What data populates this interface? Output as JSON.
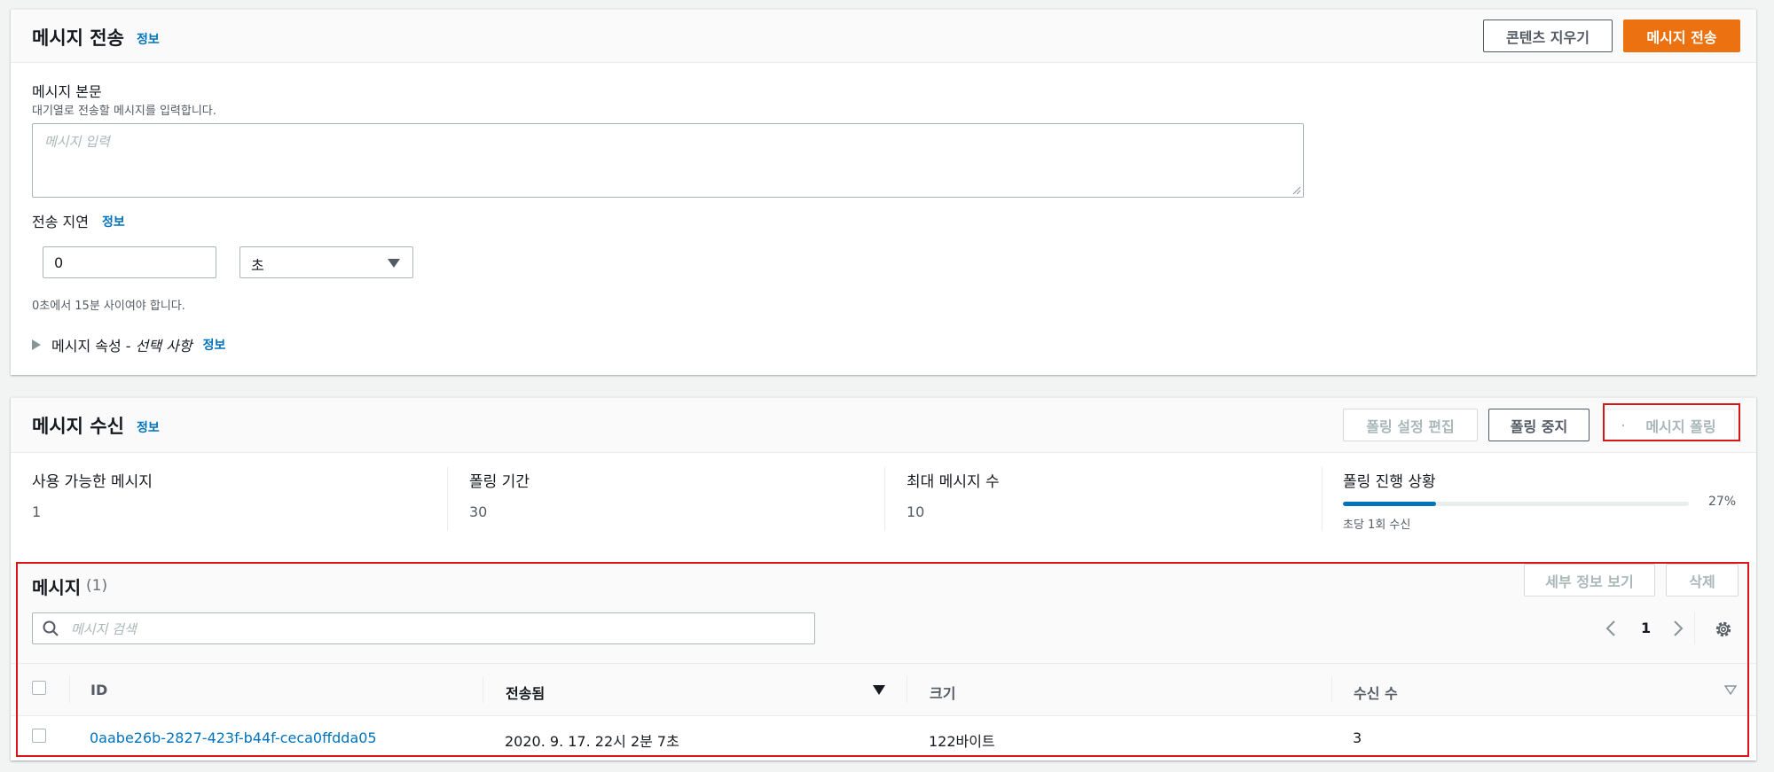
{
  "send": {
    "title": "메시지 전송",
    "info": "정보",
    "clear_button": "콘텐츠 지우기",
    "send_button": "메시지 전송",
    "body_label": "메시지 본문",
    "body_desc": "대기열로 전송할 메시지를 입력합니다.",
    "body_placeholder": "메시지 입력",
    "delay_label": "전송 지연",
    "delay_info": "정보",
    "delay_value": "0",
    "delay_unit": "초",
    "delay_hint": "0초에서 15분 사이여야 합니다.",
    "attributes_label": "메시지 속성 - ",
    "attributes_optional": "선택 사항",
    "attributes_info": "정보"
  },
  "receive": {
    "title": "메시지 수신",
    "info": "정보",
    "edit_polling_button": "폴링 설정 편집",
    "stop_polling_button": "폴링 중지",
    "poll_button": "메시지 폴링",
    "metrics": [
      {
        "label": "사용 가능한 메시지",
        "value": "1"
      },
      {
        "label": "폴링 기간",
        "value": "30"
      },
      {
        "label": "최대 메시지 수",
        "value": "10"
      }
    ],
    "progress": {
      "label": "폴링 진행 상황",
      "value_text": "27%",
      "fraction": 0.27,
      "sub": "초당 1회 수신"
    }
  },
  "messages": {
    "title": "메시지",
    "count": "(1)",
    "details_button": "세부 정보 보기",
    "delete_button": "삭제",
    "search_placeholder": "메시지 검색",
    "page": "1",
    "columns": [
      "ID",
      "전송됨",
      "크기",
      "수신 수"
    ],
    "rows": [
      {
        "id": "0aabe26b-2827-423f-b44f-ceca0ffdda05",
        "sent": "2020. 9. 17. 22시 2분 7초",
        "size": "122바이트",
        "receives": "3"
      }
    ]
  },
  "colors": {
    "accent": "#ec7211",
    "link": "#0073bb",
    "highlight": "#d91515",
    "progress": "#0073bb"
  }
}
